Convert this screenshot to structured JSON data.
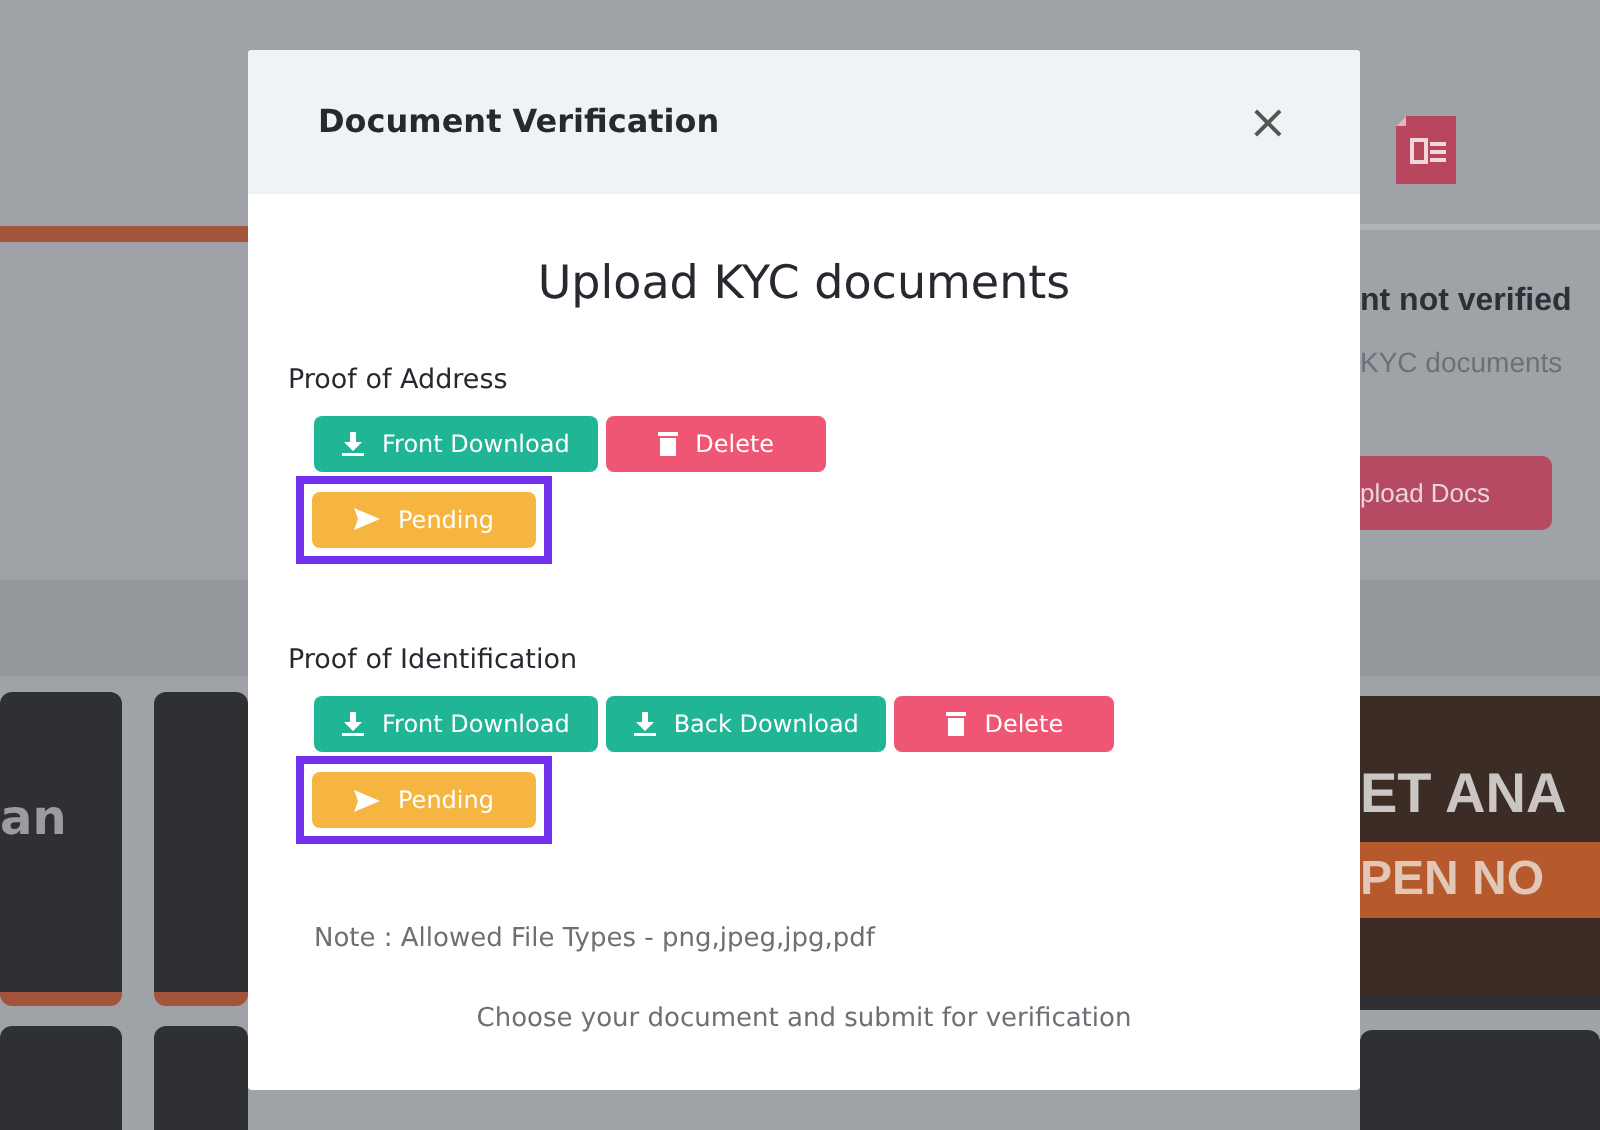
{
  "background": {
    "card_text": "an",
    "status_title": "nt not verified",
    "status_text": "KYC documents",
    "upload_button": "pload Docs",
    "banner_title": "ET ANA",
    "banner_cta": "PEN NO"
  },
  "modal": {
    "title": "Document Verification",
    "close": "×",
    "heading": "Upload KYC documents",
    "sections": [
      {
        "label": "Proof of Address",
        "actions": [
          {
            "kind": "download",
            "label": "Front Download"
          },
          {
            "kind": "delete",
            "label": "Delete"
          }
        ],
        "status": {
          "label": "Pending",
          "highlighted": true
        }
      },
      {
        "label": "Proof of Identification",
        "actions": [
          {
            "kind": "download",
            "label": "Front Download"
          },
          {
            "kind": "download",
            "label": "Back Download"
          },
          {
            "kind": "delete",
            "label": "Delete"
          }
        ],
        "status": {
          "label": "Pending",
          "highlighted": true
        }
      }
    ],
    "note": "Note : Allowed File Types - png,jpeg,jpg,pdf",
    "footer": "Choose your document and submit for verification"
  }
}
